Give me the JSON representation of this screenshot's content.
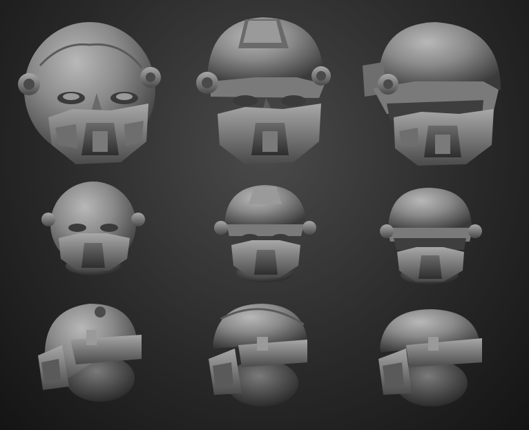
{
  "scene": {
    "subject": "sculpted-helmet-heads-turnaround",
    "background_color": "#2c2c2c",
    "material_color": "#8a8a8a",
    "rows": [
      {
        "view": "front-large",
        "cells": [
          "bare-head",
          "helmet-crest",
          "helmet-full-visor"
        ]
      },
      {
        "view": "front-small",
        "cells": [
          "bare-head",
          "helmet-crest",
          "helmet-full-visor"
        ]
      },
      {
        "view": "side-profile",
        "cells": [
          "bare-head",
          "helmet-crest",
          "helmet-full-visor"
        ]
      }
    ]
  }
}
